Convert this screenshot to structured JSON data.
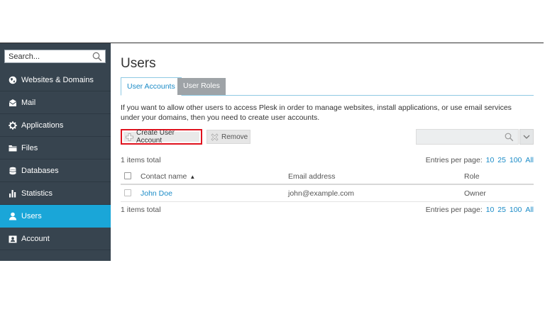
{
  "sidebar": {
    "search": {
      "placeholder": "Search..."
    },
    "items": [
      {
        "label": "Websites & Domains",
        "icon": "globe-icon"
      },
      {
        "label": "Mail",
        "icon": "envelope-icon"
      },
      {
        "label": "Applications",
        "icon": "gear-icon"
      },
      {
        "label": "Files",
        "icon": "folder-icon"
      },
      {
        "label": "Databases",
        "icon": "database-icon"
      },
      {
        "label": "Statistics",
        "icon": "bar-chart-icon"
      },
      {
        "label": "Users",
        "icon": "user-icon",
        "active": true
      },
      {
        "label": "Account",
        "icon": "id-card-icon"
      }
    ]
  },
  "main": {
    "title": "Users",
    "tabs": [
      {
        "label": "User Accounts",
        "active": true
      },
      {
        "label": "User Roles",
        "active": false
      }
    ],
    "description": "If you want to allow other users to access Plesk in order to manage websites, install applications, or use email services under your domains, then you need to create user accounts.",
    "toolbar": {
      "create_label": "Create User Account",
      "remove_label": "Remove"
    },
    "list": {
      "total_label": "1 items total",
      "entries_label": "Entries per page:",
      "page_sizes": [
        "10",
        "25",
        "100",
        "All"
      ],
      "columns": {
        "name": "Contact name",
        "email": "Email address",
        "role": "Role"
      },
      "rows": [
        {
          "name": "John Doe",
          "email": "john@example.com",
          "role": "Owner"
        }
      ]
    }
  },
  "colors": {
    "sidebar_bg": "#37444f",
    "active_item": "#1aa6d8",
    "link": "#1a8bc7",
    "highlight_border": "#e0121e"
  }
}
